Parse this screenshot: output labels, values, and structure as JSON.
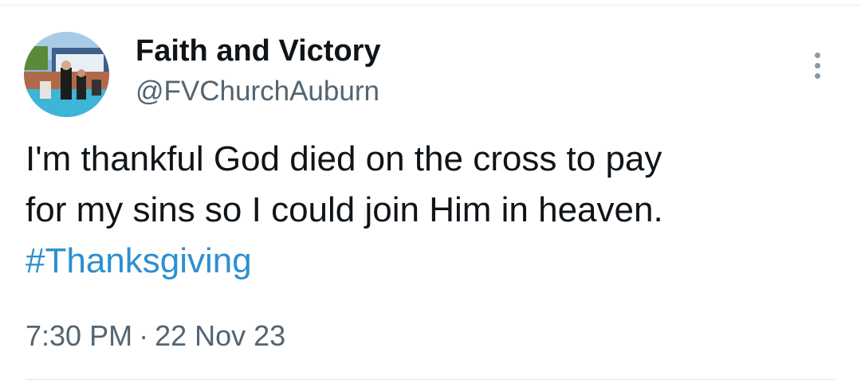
{
  "author": {
    "display_name": "Faith and Victory",
    "handle": "@FVChurchAuburn",
    "avatar_icon": "profile-photo"
  },
  "tweet": {
    "text_lines": [
      "I'm thankful God died on the cross to pay",
      "for my sins so I could join Him in heaven."
    ],
    "hashtag": "#Thanksgiving"
  },
  "meta": {
    "time": "7:30 PM",
    "separator": "·",
    "date": "22 Nov 23"
  },
  "icons": {
    "more_menu": "more-vertical-icon"
  },
  "colors": {
    "text": "#0f1419",
    "secondary": "#536471",
    "link": "#2d8fd0",
    "divider": "#e1e6ea"
  }
}
